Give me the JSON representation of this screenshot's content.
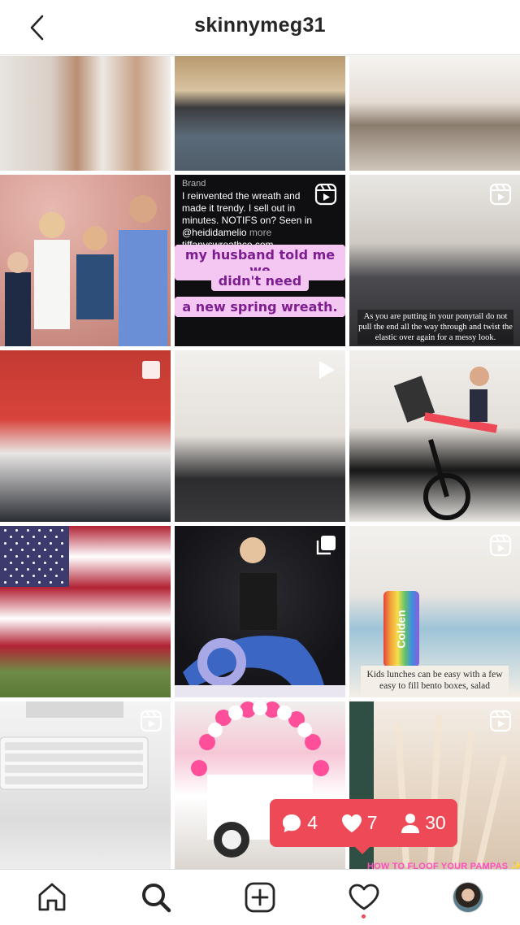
{
  "header": {
    "title": "skinnymeg31",
    "back_icon": "chevron-left-icon"
  },
  "grid": {
    "tiles": [
      {
        "id": 1,
        "badge": null
      },
      {
        "id": 2,
        "badge": null
      },
      {
        "id": 3,
        "badge": null
      },
      {
        "id": 4,
        "badge": null
      },
      {
        "id": 5,
        "badge": "reels-icon",
        "caption": {
          "brand": "Brand",
          "text": "I reinvented the wreath and made it trendy. I sell out in minutes. NOTIFS on? Seen in @heididamelio",
          "more": "more",
          "handle": "tiffanyswreathco.com",
          "lines": [
            "my husband told me we",
            "didn't need",
            "a new spring wreath."
          ]
        }
      },
      {
        "id": 6,
        "badge": "reels-icon",
        "overlay": "As you are putting in your ponytail do not pull the end all the way through and twist the elastic over again for a messy look."
      },
      {
        "id": 7,
        "badge": "square-icon"
      },
      {
        "id": 8,
        "badge": "play-icon"
      },
      {
        "id": 9,
        "badge": null
      },
      {
        "id": 10,
        "badge": null
      },
      {
        "id": 11,
        "badge": "carousel-icon"
      },
      {
        "id": 12,
        "badge": "reels-icon",
        "bottle_text": "Colden",
        "overlay": "Kids lunches can be easy with a few easy to fill bento boxes, salad"
      },
      {
        "id": 13,
        "badge": "reels-icon"
      },
      {
        "id": 14,
        "badge": null
      },
      {
        "id": 15,
        "badge": "reels-icon",
        "overlay": "HOW TO FLOOF YOUR PAMPAS ✨"
      }
    ]
  },
  "notification": {
    "comments": "4",
    "likes": "7",
    "followers": "30",
    "color": "#ed4956"
  },
  "bottom_nav": {
    "items": [
      "home-icon",
      "search-icon",
      "new-post-icon",
      "activity-heart-icon",
      "profile-avatar"
    ]
  }
}
